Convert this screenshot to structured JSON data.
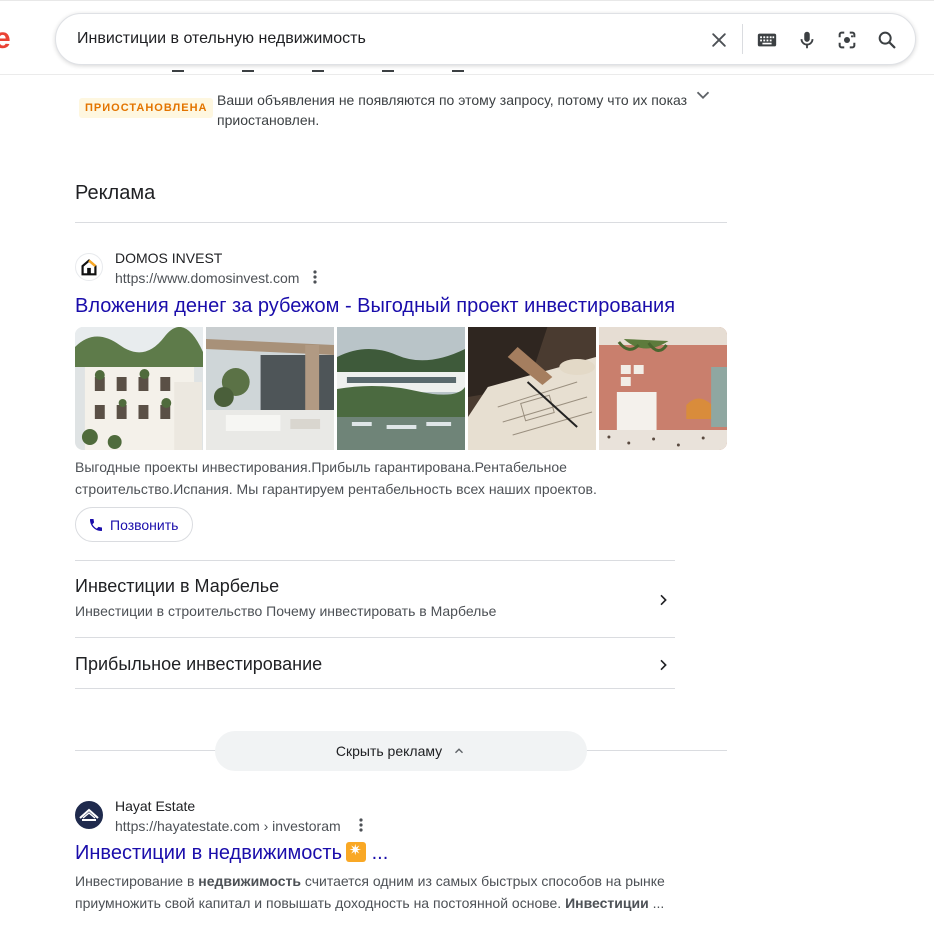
{
  "search": {
    "query": "Инвистиции в отельную недвижимость",
    "logo_fragment": "e"
  },
  "paused": {
    "badge": "ПРИОСТАНОВЛЕНА",
    "message": "Ваши объявления не появляются по этому запросу, потому что их показ приостановлен."
  },
  "ads": {
    "heading": "Реклама",
    "ad": {
      "site_name": "DOMOS INVEST",
      "url": "https://www.domosinvest.com",
      "title": "Вложения денег за рубежом - Выгодный проект инвестирования",
      "description": "Выгодные проекты инвестирования.Прибыль гарантирована.Рентабельное строительство.Испания. Мы гарантируем рентабельность всех наших проектов.",
      "call_label": "Позвонить",
      "sitelinks": [
        {
          "title": "Инвестиции в Марбелье",
          "subtitle": "Инвестиции в строительство Почему инвестировать в Марбелье"
        },
        {
          "title": "Прибыльное инвестирование",
          "subtitle": ""
        }
      ]
    },
    "hide_label": "Скрыть рекламу"
  },
  "organic": {
    "site_name": "Hayat Estate",
    "url": "https://hayatestate.com › investoram",
    "title": "Инвестиции в недвижимость",
    "title_suffix": "...",
    "desc_part1": "Инвестирование в ",
    "desc_bold1": "недвижимость",
    "desc_part2": " считается одним из самых быстрых способов на рынке приумножить свой капитал и повышать доходность на постоянной основе. ",
    "desc_bold2": "Инвестиции",
    "desc_part3": " ..."
  },
  "colors": {
    "link": "#1a0dab",
    "badge_bg": "#fef7e0",
    "badge_text": "#e37400"
  }
}
